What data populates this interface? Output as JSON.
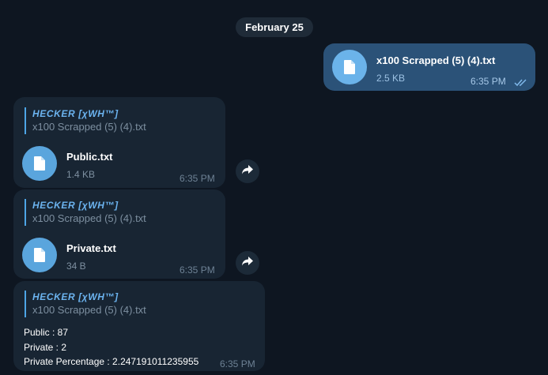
{
  "date_separator": "February 25",
  "outgoing": {
    "file_name": "x100 Scrapped (5) (4).txt",
    "file_size": "2.5 KB",
    "time": "6:35 PM",
    "status_icon": "double-check-icon"
  },
  "messages": [
    {
      "sender": "HECKER [χWH™]",
      "quoted_file": "x100 Scrapped (5) (4).txt",
      "file_name": "Public.txt",
      "file_size": "1.4 KB",
      "time": "6:35 PM"
    },
    {
      "sender": "HECKER [χWH™]",
      "quoted_file": "x100 Scrapped (5) (4).txt",
      "file_name": "Private.txt",
      "file_size": "34 B",
      "time": "6:35 PM"
    },
    {
      "sender": "HECKER [χWH™]",
      "quoted_file": "x100 Scrapped (5) (4).txt",
      "lines": [
        "Public : 87",
        "Private : 2",
        "Private Percentage : 2.247191011235955"
      ],
      "time": "6:35 PM"
    }
  ],
  "colors": {
    "background": "#0e1621",
    "incoming_bubble": "#182533",
    "outgoing_bubble": "#2b5278",
    "accent": "#5aa5dd",
    "sender_name": "#6cb4f0"
  }
}
